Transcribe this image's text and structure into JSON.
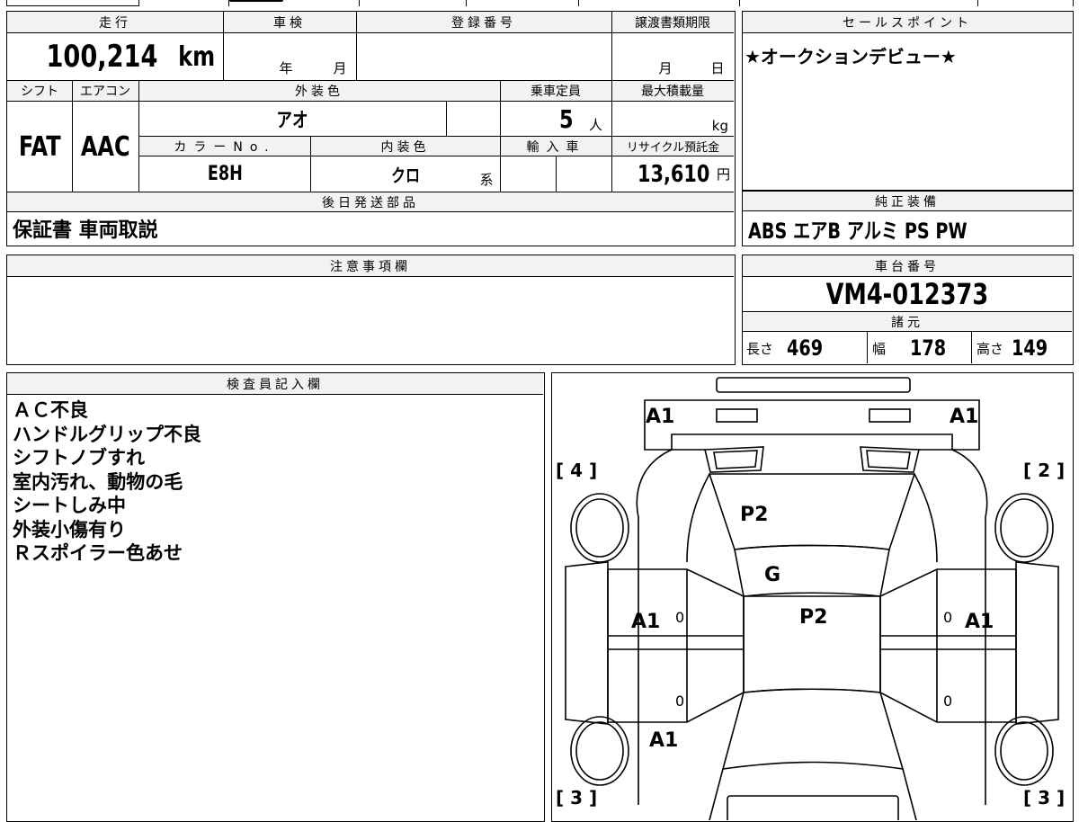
{
  "mileage": {
    "header": "走行",
    "value": "100,214",
    "unit": "km"
  },
  "shaken": {
    "header": "車検",
    "year": "年",
    "month": "月"
  },
  "registration": {
    "header": "登録番号",
    "value": ""
  },
  "transfer_deadline": {
    "header": "譲渡書類期限",
    "month": "月",
    "day": "日"
  },
  "sales_point": {
    "header": "セールスポイント",
    "text": "★オークションデビュー★"
  },
  "shift": {
    "header": "シフト",
    "value": "FAT"
  },
  "aircon": {
    "header": "エアコン",
    "value": "AAC"
  },
  "exterior_color": {
    "header": "外装色",
    "value": "アオ"
  },
  "capacity": {
    "header": "乗車定員",
    "value": "5",
    "unit": "人"
  },
  "max_load": {
    "header": "最大積載量",
    "value": "",
    "unit": "kg"
  },
  "color_no": {
    "header": "カラーNo.",
    "value": "E8H"
  },
  "interior_color": {
    "header": "内装色",
    "value": "クロ",
    "suffix": "系"
  },
  "import_car": {
    "header": "輸入車",
    "value": ""
  },
  "recycle_fee": {
    "header": "リサイクル預託金",
    "value": "13,610",
    "unit": "円"
  },
  "later_parts": {
    "header": "後日発送部品",
    "value": "保証書 車両取説"
  },
  "equipment": {
    "header": "純正装備",
    "value": "ABS エアB アルミ PS PW"
  },
  "caution": {
    "header": "注意事項欄",
    "value": ""
  },
  "chassis_no": {
    "header": "車台番号",
    "value": "VM4-012373"
  },
  "specs": {
    "header": "諸元",
    "length_label": "長さ",
    "length": "469",
    "width_label": "幅",
    "width": "178",
    "height_label": "高さ",
    "height": "149"
  },
  "inspector": {
    "header": "検査員記入欄",
    "notes": [
      "ＡＣ不良",
      "ハンドルグリップ不良",
      "シフトノブすれ",
      "室内汚れ、動物の毛",
      "シートしみ中",
      "外装小傷有り",
      "Ｒスポイラー色あせ"
    ]
  },
  "diagram": {
    "labels": {
      "front_left": "A1",
      "front_right": "A1",
      "hood": "P2",
      "windshield": "G",
      "roof": "P2",
      "left_door": "A1",
      "right_door": "A1",
      "rear_left": "A1",
      "left_front_tire": "[ 4 ]",
      "right_front_tire": "[ 2 ]",
      "left_rear_tire": "[ 3 ]",
      "right_rear_tire": "[ 3 ]",
      "zero_a": "0",
      "zero_b": "0",
      "zero_c": "0",
      "zero_d": "0"
    }
  }
}
